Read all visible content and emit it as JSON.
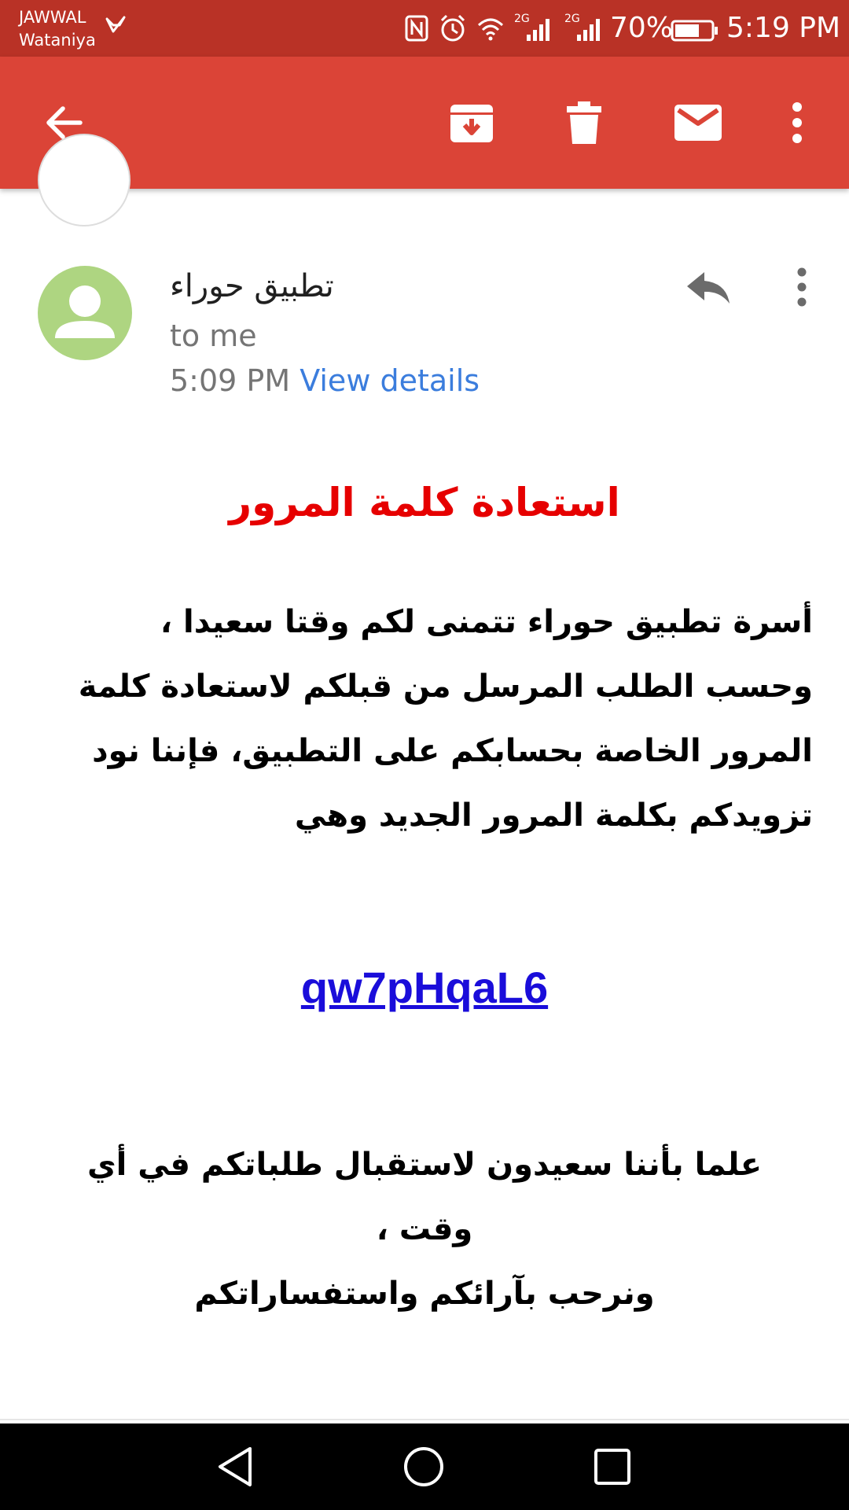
{
  "status_bar": {
    "carrier_1": "JAWWAL",
    "carrier_2": "Wataniya",
    "network_1": "2G",
    "network_2": "2G",
    "battery_percent": "70%",
    "time": "5:19 PM",
    "icons": [
      "nfc-icon",
      "alarm-icon",
      "wifi-icon",
      "signal-icon",
      "signal-icon",
      "battery-icon"
    ]
  },
  "toolbar": {
    "icons": [
      "back-arrow-icon",
      "archive-icon",
      "delete-icon",
      "mark-unread-icon",
      "more-vert-icon"
    ]
  },
  "message": {
    "sender": "تطبيق حوراء",
    "recipient": "to me",
    "time": "5:09 PM",
    "view_details_label": "View details",
    "heading": "استعادة كلمة المرور",
    "paragraph": "أسرة تطبيق حوراء تتمنى لكم وقتا سعيدا ، وحسب الطلب المرسل من قبلكم لاستعادة كلمة المرور الخاصة بحسابكم على التطبيق، فإننا نود تزويدكم بكلمة المرور الجديد وهي",
    "new_password": "qw7pHqaL6",
    "closing_line_1": "علما بأننا سعيدون لاستقبال طلباتكم في أي وقت ،",
    "closing_line_2": "ونرحب بآرائكم واستفساراتكم"
  },
  "colors": {
    "status_bar": "#b93226",
    "toolbar": "#db4437",
    "avatar": "#aed581",
    "heading": "#e60000",
    "link": "#1a0dda",
    "view_details": "#3b7ddd"
  },
  "nav_bar": {
    "icons": [
      "nav-back-icon",
      "nav-home-icon",
      "nav-recents-icon"
    ]
  }
}
